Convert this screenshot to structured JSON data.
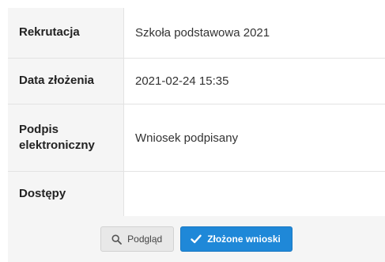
{
  "details": {
    "rows": [
      {
        "label": "Rekrutacja",
        "value": "Szkoła podstawowa 2021"
      },
      {
        "label": "Data złożenia",
        "value": "2021-02-24 15:35"
      },
      {
        "label": "Podpis elektroniczny",
        "value": "Wniosek podpisany"
      },
      {
        "label": "Dostępy",
        "value": ""
      }
    ]
  },
  "actions": {
    "preview_label": "Podgląd",
    "preview_icon": "search-icon",
    "submitted_label": "Złożone wnioski",
    "submitted_icon": "check-icon"
  },
  "colors": {
    "primary": "#1f88d8",
    "label_bg": "#f5f5f5",
    "border": "#e3e3e3"
  }
}
